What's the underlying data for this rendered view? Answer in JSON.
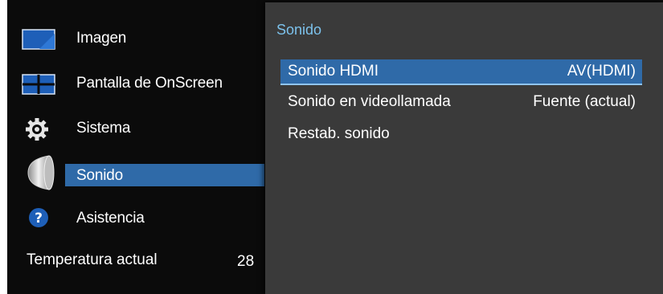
{
  "menu": {
    "items": [
      {
        "label": "Imagen",
        "icon": "picture-icon"
      },
      {
        "label": "Pantalla de OnScreen",
        "icon": "onscreen-display-icon"
      },
      {
        "label": "Sistema",
        "icon": "gear-icon"
      },
      {
        "label": "Sonido",
        "icon": "speaker-icon",
        "selected": true
      },
      {
        "label": "Asistencia",
        "icon": "help-icon"
      }
    ],
    "temperature_label": "Temperatura actual",
    "temperature_value": "28"
  },
  "panel": {
    "title": "Sonido",
    "rows": [
      {
        "label": "Sonido HDMI",
        "value": "AV(HDMI)",
        "selected": true
      },
      {
        "label": "Sonido en videollamada",
        "value": "Fuente (actual)"
      },
      {
        "label": "Restab. sonido",
        "value": ""
      }
    ]
  },
  "colors": {
    "highlight": "#2f6aa8",
    "panel_bg": "#3a3a3a",
    "title_accent": "#7cc2ec",
    "screen_bg": "#0b0b0b"
  }
}
